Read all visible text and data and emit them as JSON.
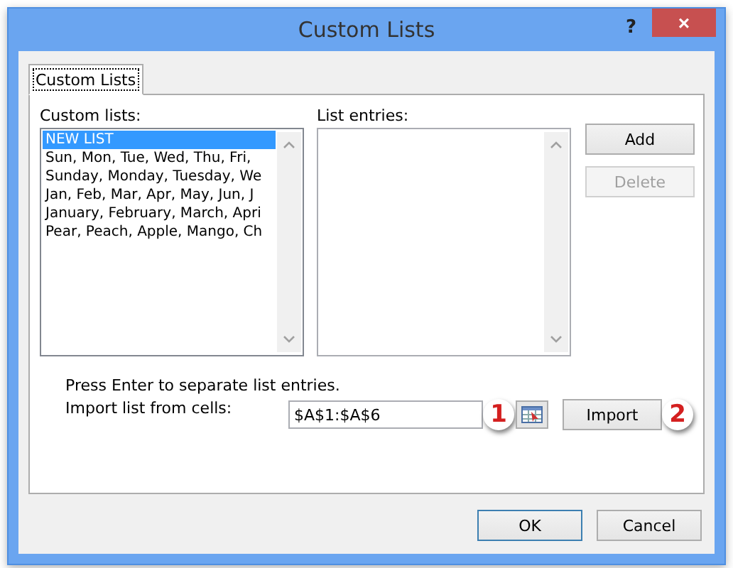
{
  "window": {
    "title": "Custom Lists",
    "help": "?",
    "close": "×"
  },
  "tabs": [
    {
      "label": "Custom Lists",
      "selected": true
    }
  ],
  "custom_lists": {
    "label": "Custom lists:",
    "items": [
      {
        "text": "NEW LIST",
        "selected": true
      },
      {
        "text": "Sun, Mon, Tue, Wed, Thu, Fri,",
        "selected": false
      },
      {
        "text": "Sunday, Monday, Tuesday, We",
        "selected": false
      },
      {
        "text": "Jan, Feb, Mar, Apr, May, Jun, J",
        "selected": false
      },
      {
        "text": "January, February, March, Apri",
        "selected": false
      },
      {
        "text": "Pear, Peach, Apple, Mango, Ch",
        "selected": false
      }
    ]
  },
  "list_entries": {
    "label": "List entries:"
  },
  "side_buttons": [
    {
      "label": "Add",
      "disabled": false
    },
    {
      "label": "Delete",
      "disabled": true
    }
  ],
  "hint": "Press Enter to separate list entries.",
  "import": {
    "label": "Import list from cells:",
    "value": "$A$1:$A$6",
    "button": "Import",
    "badges": [
      "1",
      "2"
    ]
  },
  "footer_buttons": [
    {
      "label": "OK",
      "default": true
    },
    {
      "label": "Cancel",
      "default": false
    }
  ]
}
